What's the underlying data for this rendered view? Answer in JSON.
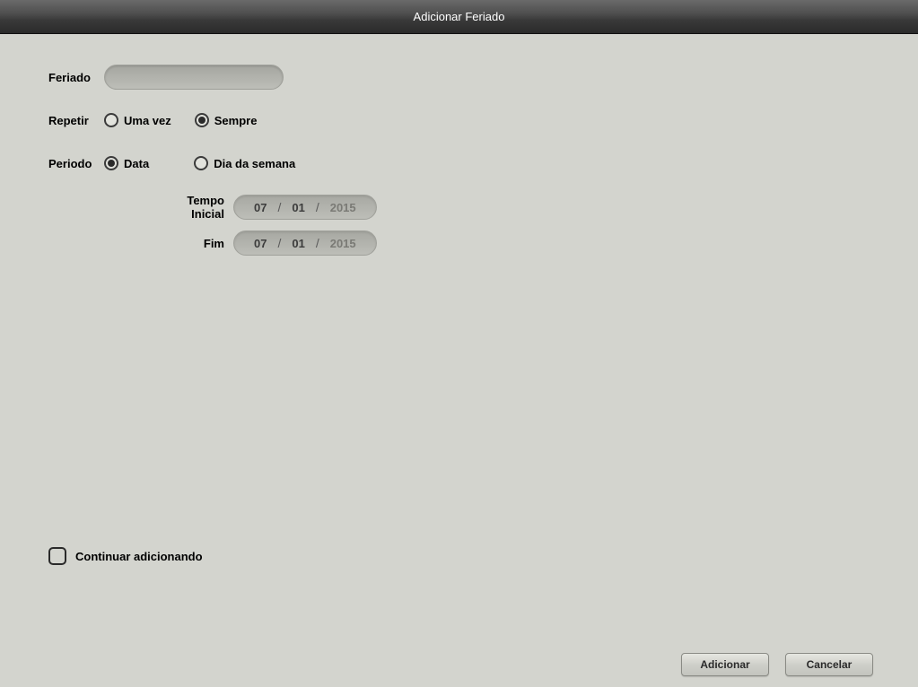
{
  "title": "Adicionar Feriado",
  "labels": {
    "feriado": "Feriado",
    "repetir": "Repetir",
    "periodo": "Periodo",
    "tempoInicial": "Tempo Inicial",
    "fim": "Fim",
    "continuarAdicionando": "Continuar adicionando"
  },
  "inputs": {
    "feriado_value": ""
  },
  "radios": {
    "repetir": {
      "umaVez": "Uma vez",
      "sempre": "Sempre",
      "selected": "sempre"
    },
    "periodo": {
      "data": "Data",
      "diaSemana": "Dia da semana",
      "selected": "data"
    }
  },
  "dates": {
    "start": {
      "month": "07",
      "day": "01",
      "year": "2015"
    },
    "end": {
      "month": "07",
      "day": "01",
      "year": "2015"
    }
  },
  "checkbox": {
    "continuar_checked": false
  },
  "buttons": {
    "adicionar": "Adicionar",
    "cancelar": "Cancelar"
  }
}
